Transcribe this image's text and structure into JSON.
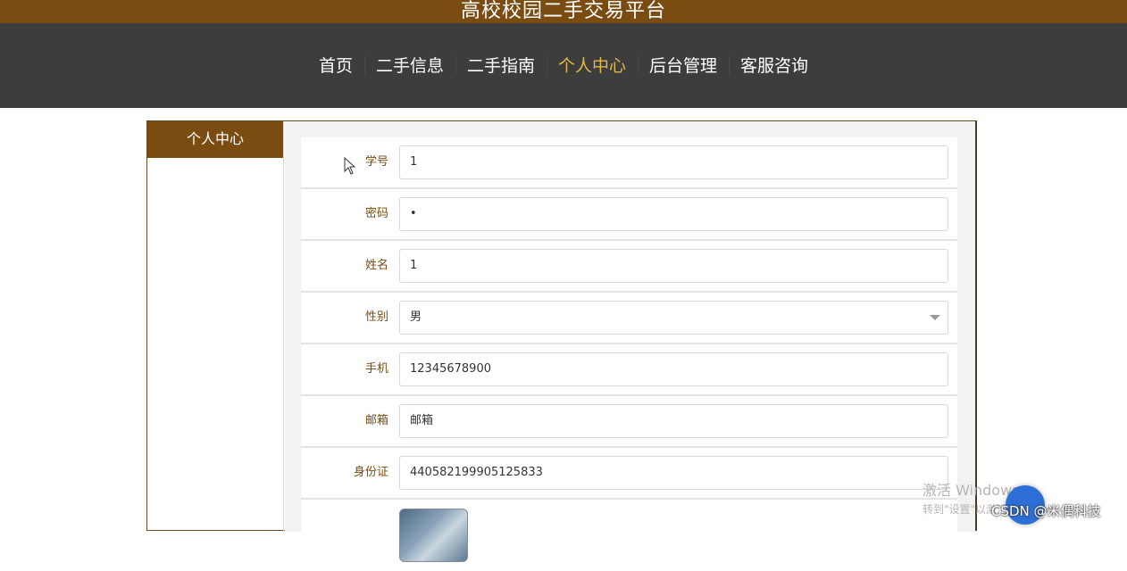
{
  "header": {
    "site_title": "高校校园二手交易平台"
  },
  "nav": {
    "items": [
      {
        "label": "首页"
      },
      {
        "label": "二手信息"
      },
      {
        "label": "二手指南"
      },
      {
        "label": "个人中心"
      },
      {
        "label": "后台管理"
      },
      {
        "label": "客服咨询"
      }
    ],
    "active": "个人中心"
  },
  "sidebar": {
    "title": "个人中心"
  },
  "form": {
    "student_id": {
      "label": "学号",
      "value": "1"
    },
    "password": {
      "label": "密码",
      "value": "•"
    },
    "name": {
      "label": "姓名",
      "value": "1"
    },
    "gender": {
      "label": "性别",
      "value": "男"
    },
    "phone": {
      "label": "手机",
      "value": "12345678900"
    },
    "email": {
      "label": "邮箱",
      "value": "邮箱"
    },
    "id_card": {
      "label": "身份证",
      "value": "440582199905125833"
    }
  },
  "overlay": {
    "windows_watermark": "激活 Windows",
    "windows_watermark_sub": "转到\"设置\"以激活Windows。",
    "csdn_credit": "CSDN @米偶科技"
  },
  "colors": {
    "brand": "#7a4c12",
    "nav_bg": "#3d3d3d",
    "nav_active": "#e0b84a"
  }
}
